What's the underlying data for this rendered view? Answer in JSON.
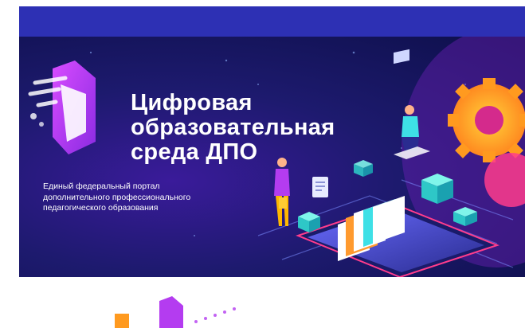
{
  "banner": {
    "title_lines": [
      "Цифровая",
      "образовательная",
      "среда ДПО"
    ],
    "subtitle": "Единый федеральный портал дополнительного профессионального педагогического образования"
  },
  "colors": {
    "top_bar": "#2d30b4",
    "banner_bg": "#1d1a6e",
    "accent_purple": "#b43cf0",
    "accent_orange": "#ff8a1f",
    "accent_cyan": "#3ee0e6",
    "accent_pink": "#ff3c8c"
  },
  "icons": [
    "logo-icon",
    "gear-icon",
    "smartphone-icon",
    "person-icon",
    "laptop-icon",
    "books-icon",
    "document-icon",
    "cube-icon"
  ]
}
